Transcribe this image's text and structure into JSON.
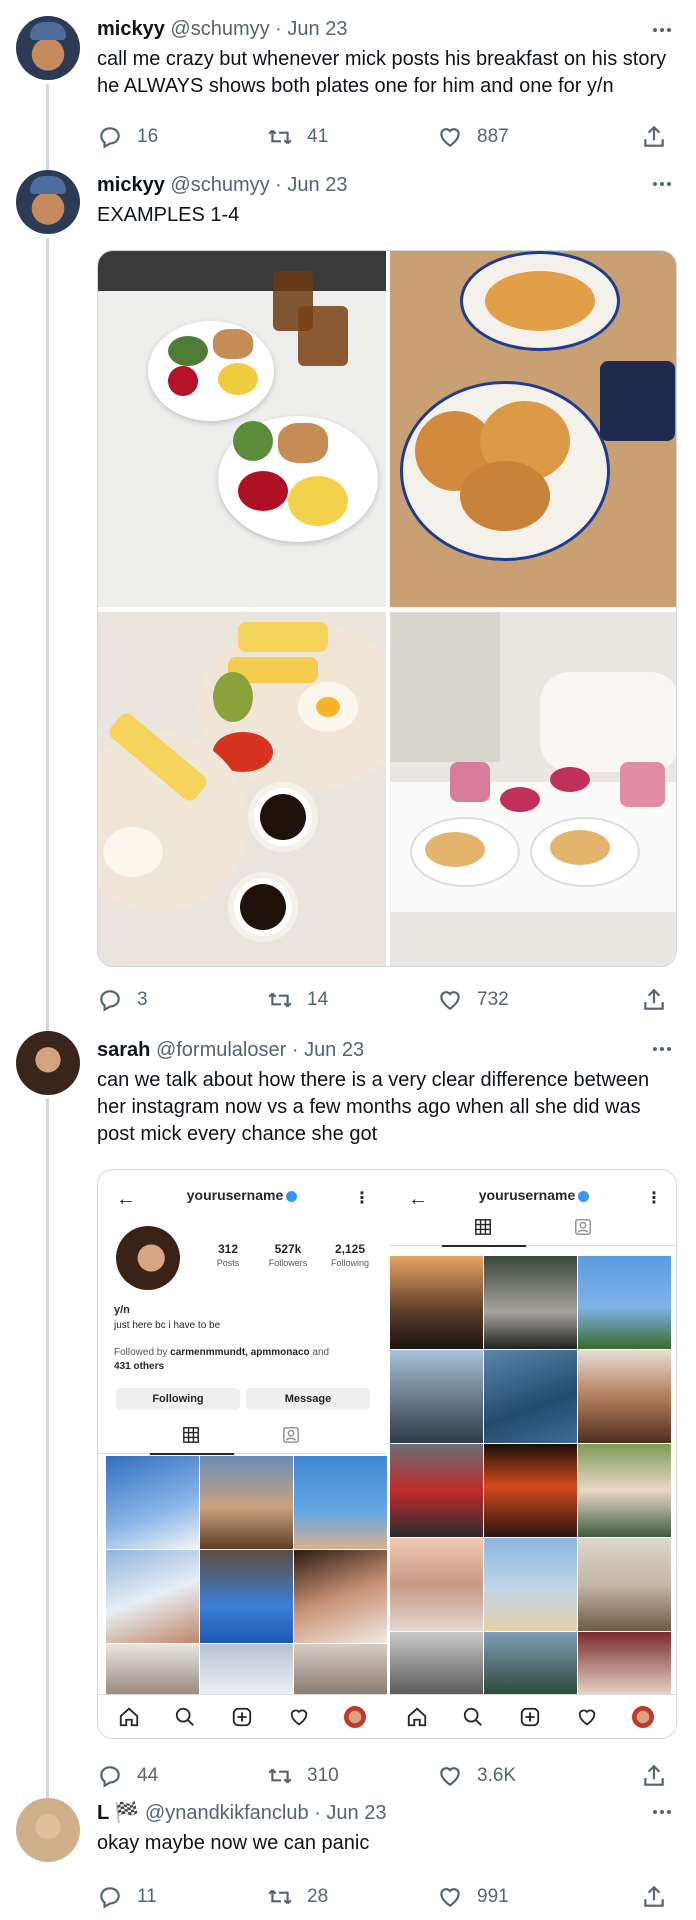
{
  "tweets": [
    {
      "name": "mickyy",
      "handle": "@schumyy",
      "date": "Jun 23",
      "text": "call me crazy but whenever mick posts his breakfast on his story he ALWAYS shows both plates one for him and one for y/n",
      "replies": "16",
      "retweets": "41",
      "likes": "887"
    },
    {
      "name": "mickyy",
      "handle": "@schumyy",
      "date": "Jun 23",
      "text": "EXAMPLES 1-4",
      "replies": "3",
      "retweets": "14",
      "likes": "732"
    },
    {
      "name": "sarah",
      "handle": "@formulaloser",
      "date": "Jun 23",
      "text": "can we talk about how there is a very clear difference between her instagram now vs a few months ago when all she did was post mick every chance she got",
      "replies": "44",
      "retweets": "310",
      "likes": "3.6K"
    },
    {
      "name": "L 🏁",
      "handle": "@ynandkikfanclub",
      "date": "Jun 23",
      "text": "okay maybe now we can panic",
      "replies": "11",
      "retweets": "28",
      "likes": "991"
    }
  ],
  "separator": " · ",
  "instagram_left": {
    "username": "yourusername",
    "posts": "312",
    "posts_label": "Posts",
    "followers": "527k",
    "followers_label": "Followers",
    "following": "2,125",
    "following_label": "Following",
    "bio_name": "y/n",
    "bio_text": "just here bc i have to be",
    "followed_by_prefix": "Followed by ",
    "followed_by_names": "carmenmmundt, apmmonaco",
    "followed_by_and": " and",
    "followed_by_others": "431 others",
    "following_button": "Following",
    "message_button": "Message"
  },
  "instagram_right": {
    "username": "yourusername"
  },
  "colors": {
    "text": "#0f1419",
    "secondary": "#536471",
    "border": "#cfd9de",
    "verified": "#3897f0"
  }
}
